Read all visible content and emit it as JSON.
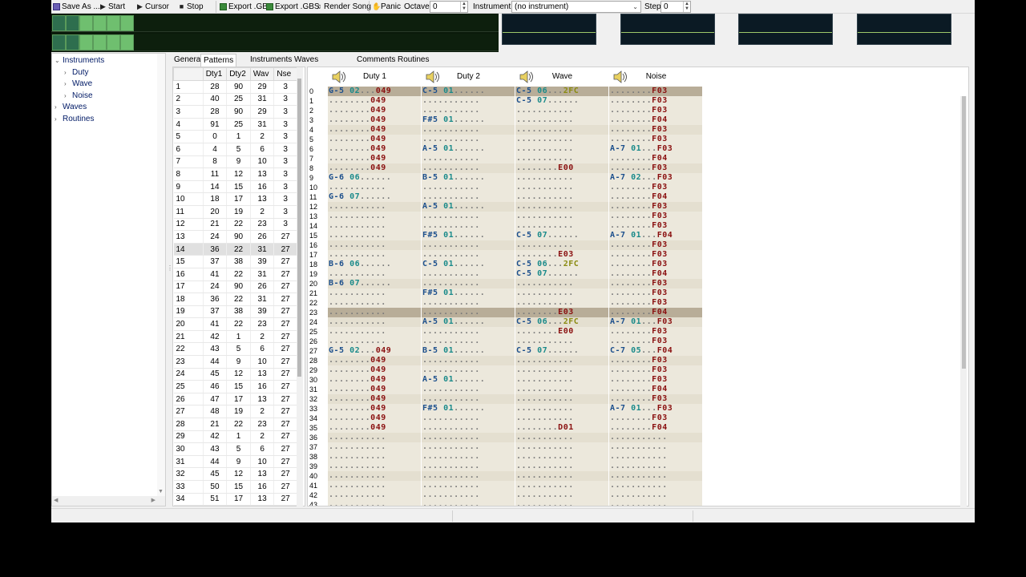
{
  "toolbar": {
    "save_as": "Save As ...",
    "start": "Start",
    "cursor": "Cursor",
    "stop": "Stop",
    "export_gb": "Export .GB",
    "export_gbs": "Export .GBS",
    "render_song": "Render Song",
    "panic": "Panic",
    "octave_label": "Octave",
    "octave_value": "0",
    "instrument_label": "Instrument",
    "instrument_value": "(no instrument)",
    "step_label": "Step",
    "step_value": "0"
  },
  "tree": {
    "items": [
      {
        "label": "Instruments",
        "level": 0,
        "expander": "⌄"
      },
      {
        "label": "Duty",
        "level": 1,
        "expander": "›"
      },
      {
        "label": "Wave",
        "level": 1,
        "expander": "›"
      },
      {
        "label": "Noise",
        "level": 1,
        "expander": "›"
      },
      {
        "label": "Waves",
        "level": 0,
        "expander": "›"
      },
      {
        "label": "Routines",
        "level": 0,
        "expander": "›"
      }
    ]
  },
  "tabs": [
    "General",
    "Patterns",
    "Instruments",
    "Waves",
    "Comments",
    "Routines"
  ],
  "active_tab": "Patterns",
  "pattern_list": {
    "columns": [
      "",
      "Dty1",
      "Dty2",
      "Wav",
      "Nse"
    ],
    "selected_row": 14,
    "rows": [
      [
        1,
        28,
        90,
        29,
        3
      ],
      [
        2,
        40,
        25,
        31,
        3
      ],
      [
        3,
        28,
        90,
        29,
        3
      ],
      [
        4,
        91,
        25,
        31,
        3
      ],
      [
        5,
        0,
        1,
        2,
        3
      ],
      [
        6,
        4,
        5,
        6,
        3
      ],
      [
        7,
        8,
        9,
        10,
        3
      ],
      [
        8,
        11,
        12,
        13,
        3
      ],
      [
        9,
        14,
        15,
        16,
        3
      ],
      [
        10,
        18,
        17,
        13,
        3
      ],
      [
        11,
        20,
        19,
        2,
        3
      ],
      [
        12,
        21,
        22,
        23,
        3
      ],
      [
        13,
        24,
        90,
        26,
        27
      ],
      [
        14,
        36,
        22,
        31,
        27
      ],
      [
        15,
        37,
        38,
        39,
        27
      ],
      [
        16,
        41,
        22,
        31,
        27
      ],
      [
        17,
        24,
        90,
        26,
        27
      ],
      [
        18,
        36,
        22,
        31,
        27
      ],
      [
        19,
        37,
        38,
        39,
        27
      ],
      [
        20,
        41,
        22,
        23,
        27
      ],
      [
        21,
        42,
        1,
        2,
        27
      ],
      [
        22,
        43,
        5,
        6,
        27
      ],
      [
        23,
        44,
        9,
        10,
        27
      ],
      [
        24,
        45,
        12,
        13,
        27
      ],
      [
        25,
        46,
        15,
        16,
        27
      ],
      [
        26,
        47,
        17,
        13,
        27
      ],
      [
        27,
        48,
        19,
        2,
        27
      ],
      [
        28,
        21,
        22,
        23,
        27
      ],
      [
        29,
        42,
        1,
        2,
        27
      ],
      [
        30,
        43,
        5,
        6,
        27
      ],
      [
        31,
        44,
        9,
        10,
        27
      ],
      [
        32,
        45,
        12,
        13,
        27
      ],
      [
        33,
        50,
        15,
        16,
        27
      ],
      [
        34,
        51,
        17,
        13,
        27
      ]
    ]
  },
  "channels": [
    "Duty 1",
    "Duty 2",
    "Wave",
    "Noise"
  ],
  "tracker_rows": [
    [
      "G-5 02...049",
      "C-5 01......",
      "C-5 06...2FC",
      "........F03"
    ],
    [
      "........049",
      "...........",
      "C-5 07......",
      "........F03"
    ],
    [
      "........049",
      "...........",
      "...........",
      "........F03"
    ],
    [
      "........049",
      "F#5 01......",
      "...........",
      "........F04"
    ],
    [
      "........049",
      "...........",
      "...........",
      "........F03"
    ],
    [
      "........049",
      "...........",
      "...........",
      "........F03"
    ],
    [
      "........049",
      "A-5 01......",
      "...........",
      "A-7 01...F03"
    ],
    [
      "........049",
      "...........",
      "...........",
      "........F04"
    ],
    [
      "........049",
      "...........",
      "........E00",
      "........F03"
    ],
    [
      "G-6 06......",
      "B-5 01......",
      "...........",
      "A-7 02...F03"
    ],
    [
      "...........",
      "...........",
      "...........",
      "........F03"
    ],
    [
      "G-6 07......",
      "...........",
      "...........",
      "........F04"
    ],
    [
      "...........",
      "A-5 01......",
      "...........",
      "........F03"
    ],
    [
      "...........",
      "...........",
      "...........",
      "........F03"
    ],
    [
      "...........",
      "...........",
      "...........",
      "........F03"
    ],
    [
      "...........",
      "F#5 01......",
      "C-5 07......",
      "A-7 01...F04"
    ],
    [
      "...........",
      "...........",
      "...........",
      "........F03"
    ],
    [
      "...........",
      "...........",
      "........E03",
      "........F03"
    ],
    [
      "B-6 06......",
      "C-5 01......",
      "C-5 06...2FC",
      "........F03"
    ],
    [
      "...........",
      "...........",
      "C-5 07......",
      "........F04"
    ],
    [
      "B-6 07......",
      "...........",
      "...........",
      "........F03"
    ],
    [
      "...........",
      "F#5 01......",
      "...........",
      "........F03"
    ],
    [
      "...........",
      "...........",
      "...........",
      "........F03"
    ],
    [
      "...........",
      "...........",
      "........E03",
      "........F04"
    ],
    [
      "...........",
      "A-5 01......",
      "C-5 06...2FC",
      "A-7 01...F03"
    ],
    [
      "...........",
      "...........",
      "........E00",
      "........F03"
    ],
    [
      "...........",
      "...........",
      "...........",
      "........F03"
    ],
    [
      "G-5 02...049",
      "B-5 01......",
      "C-5 07......",
      "C-7 05...F04"
    ],
    [
      "........049",
      "...........",
      "...........",
      "........F03"
    ],
    [
      "........049",
      "...........",
      "...........",
      "........F03"
    ],
    [
      "........049",
      "A-5 01......",
      "...........",
      "........F03"
    ],
    [
      "........049",
      "...........",
      "...........",
      "........F04"
    ],
    [
      "........049",
      "...........",
      "...........",
      "........F03"
    ],
    [
      "........049",
      "F#5 01......",
      "...........",
      "A-7 01...F03"
    ],
    [
      "........049",
      "...........",
      "...........",
      "........F03"
    ],
    [
      "........049",
      "...........",
      "........D01",
      "........F04"
    ],
    [
      "...........",
      "...........",
      "...........",
      "..........."
    ],
    [
      "...........",
      "...........",
      "...........",
      "..........."
    ],
    [
      "...........",
      "...........",
      "...........",
      "..........."
    ],
    [
      "...........",
      "...........",
      "...........",
      "..........."
    ],
    [
      "...........",
      "...........",
      "...........",
      "..........."
    ],
    [
      "...........",
      "...........",
      "...........",
      "..........."
    ],
    [
      "...........",
      "...........",
      "...........",
      "..........."
    ],
    [
      "...........",
      "...........",
      "...........",
      "..........."
    ]
  ],
  "highlight_rows": [
    0,
    23
  ],
  "colors": {
    "meter_lit": "#6fbf6f",
    "meter_dark": "#2e6e4e",
    "note": "#1c4f8c",
    "instrument": "#1a8a8a",
    "effect": "#8a1010",
    "wave_effect": "#8a8a10",
    "cell_bg": "#ece8dc",
    "highlight_bg": "#b8ad98"
  }
}
